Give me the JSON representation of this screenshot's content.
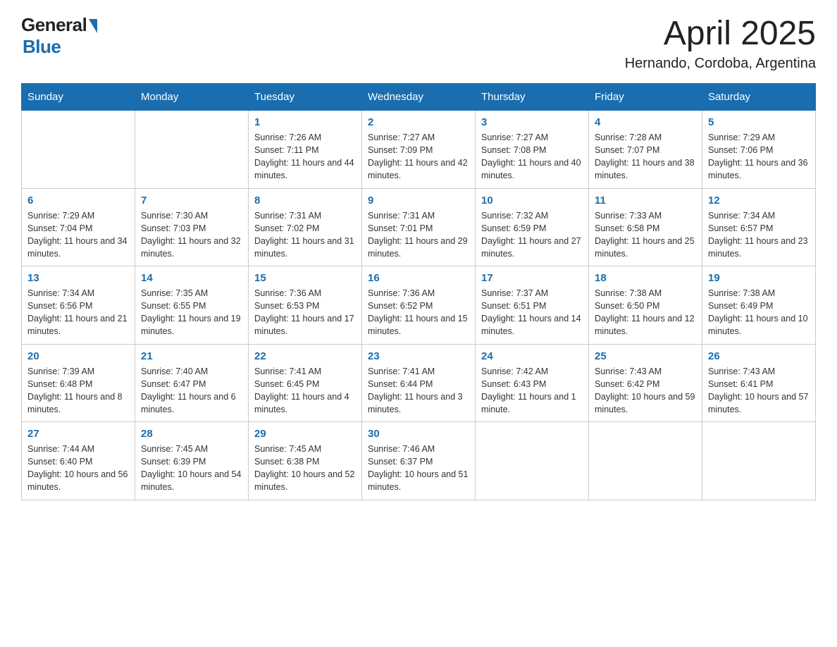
{
  "header": {
    "logo_general": "General",
    "logo_blue": "Blue",
    "month_title": "April 2025",
    "location": "Hernando, Cordoba, Argentina"
  },
  "days_of_week": [
    "Sunday",
    "Monday",
    "Tuesday",
    "Wednesday",
    "Thursday",
    "Friday",
    "Saturday"
  ],
  "weeks": [
    [
      {
        "day": "",
        "sunrise": "",
        "sunset": "",
        "daylight": ""
      },
      {
        "day": "",
        "sunrise": "",
        "sunset": "",
        "daylight": ""
      },
      {
        "day": "1",
        "sunrise": "Sunrise: 7:26 AM",
        "sunset": "Sunset: 7:11 PM",
        "daylight": "Daylight: 11 hours and 44 minutes."
      },
      {
        "day": "2",
        "sunrise": "Sunrise: 7:27 AM",
        "sunset": "Sunset: 7:09 PM",
        "daylight": "Daylight: 11 hours and 42 minutes."
      },
      {
        "day": "3",
        "sunrise": "Sunrise: 7:27 AM",
        "sunset": "Sunset: 7:08 PM",
        "daylight": "Daylight: 11 hours and 40 minutes."
      },
      {
        "day": "4",
        "sunrise": "Sunrise: 7:28 AM",
        "sunset": "Sunset: 7:07 PM",
        "daylight": "Daylight: 11 hours and 38 minutes."
      },
      {
        "day": "5",
        "sunrise": "Sunrise: 7:29 AM",
        "sunset": "Sunset: 7:06 PM",
        "daylight": "Daylight: 11 hours and 36 minutes."
      }
    ],
    [
      {
        "day": "6",
        "sunrise": "Sunrise: 7:29 AM",
        "sunset": "Sunset: 7:04 PM",
        "daylight": "Daylight: 11 hours and 34 minutes."
      },
      {
        "day": "7",
        "sunrise": "Sunrise: 7:30 AM",
        "sunset": "Sunset: 7:03 PM",
        "daylight": "Daylight: 11 hours and 32 minutes."
      },
      {
        "day": "8",
        "sunrise": "Sunrise: 7:31 AM",
        "sunset": "Sunset: 7:02 PM",
        "daylight": "Daylight: 11 hours and 31 minutes."
      },
      {
        "day": "9",
        "sunrise": "Sunrise: 7:31 AM",
        "sunset": "Sunset: 7:01 PM",
        "daylight": "Daylight: 11 hours and 29 minutes."
      },
      {
        "day": "10",
        "sunrise": "Sunrise: 7:32 AM",
        "sunset": "Sunset: 6:59 PM",
        "daylight": "Daylight: 11 hours and 27 minutes."
      },
      {
        "day": "11",
        "sunrise": "Sunrise: 7:33 AM",
        "sunset": "Sunset: 6:58 PM",
        "daylight": "Daylight: 11 hours and 25 minutes."
      },
      {
        "day": "12",
        "sunrise": "Sunrise: 7:34 AM",
        "sunset": "Sunset: 6:57 PM",
        "daylight": "Daylight: 11 hours and 23 minutes."
      }
    ],
    [
      {
        "day": "13",
        "sunrise": "Sunrise: 7:34 AM",
        "sunset": "Sunset: 6:56 PM",
        "daylight": "Daylight: 11 hours and 21 minutes."
      },
      {
        "day": "14",
        "sunrise": "Sunrise: 7:35 AM",
        "sunset": "Sunset: 6:55 PM",
        "daylight": "Daylight: 11 hours and 19 minutes."
      },
      {
        "day": "15",
        "sunrise": "Sunrise: 7:36 AM",
        "sunset": "Sunset: 6:53 PM",
        "daylight": "Daylight: 11 hours and 17 minutes."
      },
      {
        "day": "16",
        "sunrise": "Sunrise: 7:36 AM",
        "sunset": "Sunset: 6:52 PM",
        "daylight": "Daylight: 11 hours and 15 minutes."
      },
      {
        "day": "17",
        "sunrise": "Sunrise: 7:37 AM",
        "sunset": "Sunset: 6:51 PM",
        "daylight": "Daylight: 11 hours and 14 minutes."
      },
      {
        "day": "18",
        "sunrise": "Sunrise: 7:38 AM",
        "sunset": "Sunset: 6:50 PM",
        "daylight": "Daylight: 11 hours and 12 minutes."
      },
      {
        "day": "19",
        "sunrise": "Sunrise: 7:38 AM",
        "sunset": "Sunset: 6:49 PM",
        "daylight": "Daylight: 11 hours and 10 minutes."
      }
    ],
    [
      {
        "day": "20",
        "sunrise": "Sunrise: 7:39 AM",
        "sunset": "Sunset: 6:48 PM",
        "daylight": "Daylight: 11 hours and 8 minutes."
      },
      {
        "day": "21",
        "sunrise": "Sunrise: 7:40 AM",
        "sunset": "Sunset: 6:47 PM",
        "daylight": "Daylight: 11 hours and 6 minutes."
      },
      {
        "day": "22",
        "sunrise": "Sunrise: 7:41 AM",
        "sunset": "Sunset: 6:45 PM",
        "daylight": "Daylight: 11 hours and 4 minutes."
      },
      {
        "day": "23",
        "sunrise": "Sunrise: 7:41 AM",
        "sunset": "Sunset: 6:44 PM",
        "daylight": "Daylight: 11 hours and 3 minutes."
      },
      {
        "day": "24",
        "sunrise": "Sunrise: 7:42 AM",
        "sunset": "Sunset: 6:43 PM",
        "daylight": "Daylight: 11 hours and 1 minute."
      },
      {
        "day": "25",
        "sunrise": "Sunrise: 7:43 AM",
        "sunset": "Sunset: 6:42 PM",
        "daylight": "Daylight: 10 hours and 59 minutes."
      },
      {
        "day": "26",
        "sunrise": "Sunrise: 7:43 AM",
        "sunset": "Sunset: 6:41 PM",
        "daylight": "Daylight: 10 hours and 57 minutes."
      }
    ],
    [
      {
        "day": "27",
        "sunrise": "Sunrise: 7:44 AM",
        "sunset": "Sunset: 6:40 PM",
        "daylight": "Daylight: 10 hours and 56 minutes."
      },
      {
        "day": "28",
        "sunrise": "Sunrise: 7:45 AM",
        "sunset": "Sunset: 6:39 PM",
        "daylight": "Daylight: 10 hours and 54 minutes."
      },
      {
        "day": "29",
        "sunrise": "Sunrise: 7:45 AM",
        "sunset": "Sunset: 6:38 PM",
        "daylight": "Daylight: 10 hours and 52 minutes."
      },
      {
        "day": "30",
        "sunrise": "Sunrise: 7:46 AM",
        "sunset": "Sunset: 6:37 PM",
        "daylight": "Daylight: 10 hours and 51 minutes."
      },
      {
        "day": "",
        "sunrise": "",
        "sunset": "",
        "daylight": ""
      },
      {
        "day": "",
        "sunrise": "",
        "sunset": "",
        "daylight": ""
      },
      {
        "day": "",
        "sunrise": "",
        "sunset": "",
        "daylight": ""
      }
    ]
  ]
}
